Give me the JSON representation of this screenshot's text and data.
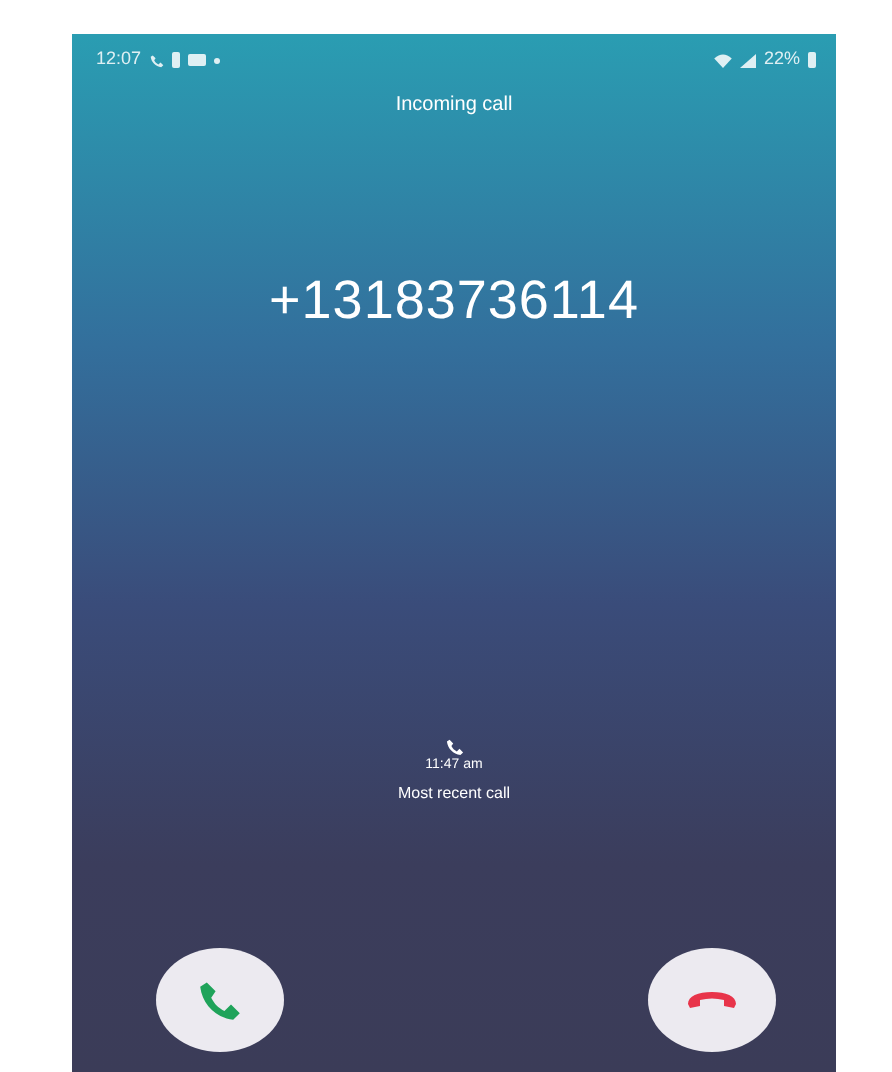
{
  "status_bar": {
    "time": "12:07",
    "battery": "22%"
  },
  "call": {
    "title": "Incoming call",
    "number": "+13183736114",
    "recent_time": "11:47 am",
    "recent_label": "Most recent call"
  },
  "buttons": [
    {
      "kind": "answer"
    },
    {
      "kind": "decline"
    }
  ]
}
